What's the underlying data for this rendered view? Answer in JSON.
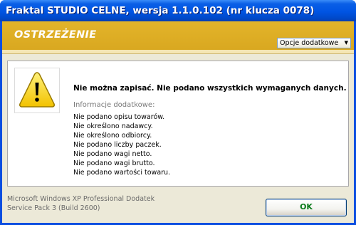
{
  "window": {
    "title": "Fraktal STUDIO CELNE, wersja 1.1.0.102 (nr klucza 0078)"
  },
  "banner": {
    "title": "OSTRZEŻENIE",
    "options_label": "Opcje dodatkowe"
  },
  "message": {
    "main": "Nie można zapisać. Nie podano wszystkich wymaganych danych.",
    "info_label": "Informacje dodatkowe:",
    "details": [
      "Nie podano opisu towarów.",
      "Nie określono nadawcy.",
      "Nie określono odbiorcy.",
      "Nie podano liczby paczek.",
      "Nie podano wagi netto.",
      "Nie podano wagi brutto.",
      "Nie podano wartości towaru."
    ]
  },
  "footer": {
    "os_line1": "Microsoft Windows XP Professional Dodatek",
    "os_line2": "Service Pack 3 (Build 2600)",
    "ok_label": "OK"
  },
  "colors": {
    "titlebar": "#0054e3",
    "banner": "#dcaa22",
    "ok_text": "#0a7a1a"
  },
  "icons": {
    "warning": "warning-triangle-icon",
    "dropdown": "chevron-down-icon"
  }
}
